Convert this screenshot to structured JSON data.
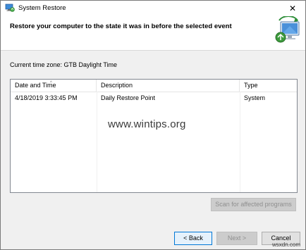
{
  "window": {
    "title": "System Restore",
    "icon": "system-restore-icon",
    "close_glyph": "✕"
  },
  "header": {
    "title": "Restore your computer to the state it was in before the selected event",
    "icon": "restore-computer-icon"
  },
  "timezone_text": "Current time zone: GTB Daylight Time",
  "table": {
    "columns": [
      "Date and Time",
      "Description",
      "Type"
    ],
    "sort_indicator": "^",
    "rows": [
      [
        "4/18/2019 3:33:45 PM",
        "Daily Restore Point",
        "System"
      ]
    ]
  },
  "watermark": "www.wintips.org",
  "buttons": {
    "scan": "Scan for affected programs",
    "back": "< Back",
    "next": "Next >",
    "cancel": "Cancel"
  },
  "site_mark": "wsxdn.com",
  "colors": {
    "focus_border": "#0078d7",
    "disabled_text": "#8f8f8f"
  }
}
